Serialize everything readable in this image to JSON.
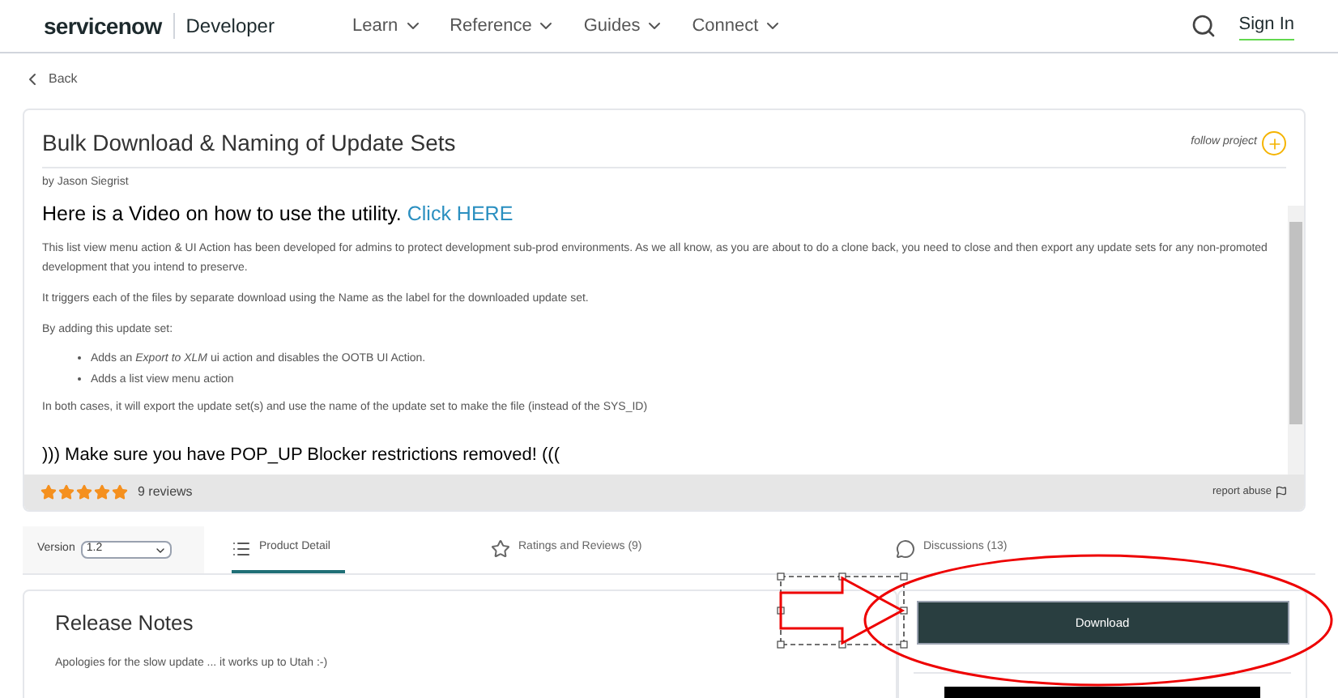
{
  "header": {
    "logo": "servicenow",
    "product": "Developer",
    "nav": [
      {
        "label": "Learn"
      },
      {
        "label": "Reference"
      },
      {
        "label": "Guides"
      },
      {
        "label": "Connect"
      }
    ],
    "sign_in": "Sign In"
  },
  "back": "Back",
  "project": {
    "title": "Bulk Download & Naming of Update Sets",
    "follow": "follow project",
    "author": "by Jason Siegrist",
    "headline": "Here is a Video on how to use the utility.",
    "headline_link": "Click HERE",
    "paragraphs": [
      "This list view menu action & UI Action has been developed for admins to protect development sub-prod environments.  As we all know, as you are about to do a clone back, you need to close and then export any update sets for any non-promoted development that you intend to preserve.",
      "It triggers each of the files by separate download using the Name as the label for the downloaded update set.",
      "By adding this update set:"
    ],
    "bullets": [
      "Adds an *Export to XLM*  ui action and disables the OOTB UI Action.",
      "Adds a list view menu action"
    ],
    "closing": "In both cases, it will export the update set(s) and use the name of the update set to make the file (instead of the SYS_ID)",
    "warning": "))) Make sure you have POP_UP Blocker restrictions removed! (((",
    "stars": 5,
    "reviews": "9 reviews",
    "report": "report abuse"
  },
  "version": {
    "label": "Version",
    "value": "1.2"
  },
  "tabs": [
    {
      "label": "Product Detail",
      "kind": "list",
      "selected": true
    },
    {
      "label": "Ratings and Reviews (9)",
      "kind": "star",
      "selected": false
    },
    {
      "label": "Discussions (13)",
      "kind": "chat",
      "selected": false
    }
  ],
  "release_notes": {
    "title": "Release Notes",
    "text": "Apologies for the slow update ... it works up to Utah :-)"
  },
  "download": "Download"
}
